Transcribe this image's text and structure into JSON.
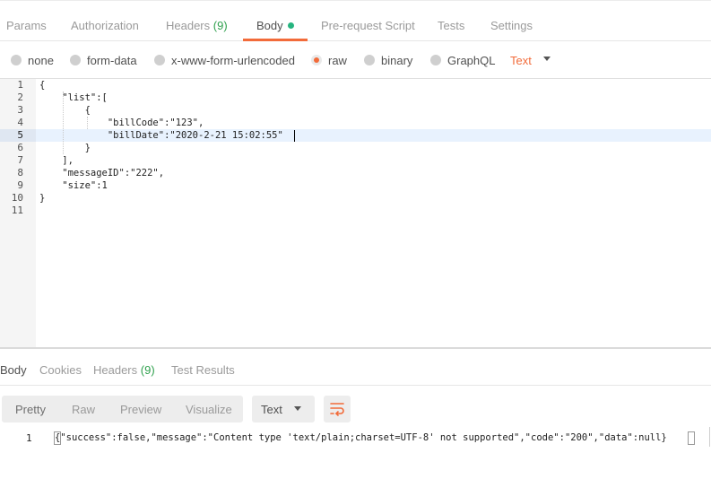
{
  "request_tabs": [
    {
      "label": "Params"
    },
    {
      "label": "Authorization"
    },
    {
      "label": "Headers",
      "count": "(9)"
    },
    {
      "label": "Body",
      "active": true
    },
    {
      "label": "Pre-request Script"
    },
    {
      "label": "Tests"
    },
    {
      "label": "Settings"
    }
  ],
  "body_types": [
    {
      "label": "none"
    },
    {
      "label": "form-data"
    },
    {
      "label": "x-www-form-urlencoded"
    },
    {
      "label": "raw",
      "selected": true
    },
    {
      "label": "binary"
    },
    {
      "label": "GraphQL"
    }
  ],
  "raw_format": "Text",
  "editor": {
    "line_numbers": [
      "1",
      "2",
      "3",
      "4",
      "5",
      "6",
      "7",
      "8",
      "9",
      "10",
      "11"
    ],
    "active_line": 5,
    "lines": [
      "{",
      "    \"list\":[",
      "        {",
      "            \"billCode\":\"123\",",
      "            \"billDate\":\"2020-2-21 15:02:55\"",
      "        }",
      "    ],",
      "    \"messageID\":\"222\",",
      "    \"size\":1",
      "}",
      ""
    ]
  },
  "response": {
    "tabs": [
      {
        "label": "Body",
        "active": true
      },
      {
        "label": "Cookies"
      },
      {
        "label": "Headers",
        "count": "(9)"
      },
      {
        "label": "Test Results"
      }
    ],
    "view_modes": [
      "Pretty",
      "Raw",
      "Preview",
      "Visualize"
    ],
    "active_view": "Pretty",
    "format": "Text",
    "wrap_icon": "wrap-lines-icon",
    "line_number": "1",
    "body": "{\"success\":false,\"message\":\"Content type 'text/plain;charset=UTF-8' not supported\",\"code\":\"200\",\"data\":null}"
  },
  "colors": {
    "accent": "#f26b3a",
    "count_green": "#30a14e",
    "active_dot": "#26b47f"
  }
}
